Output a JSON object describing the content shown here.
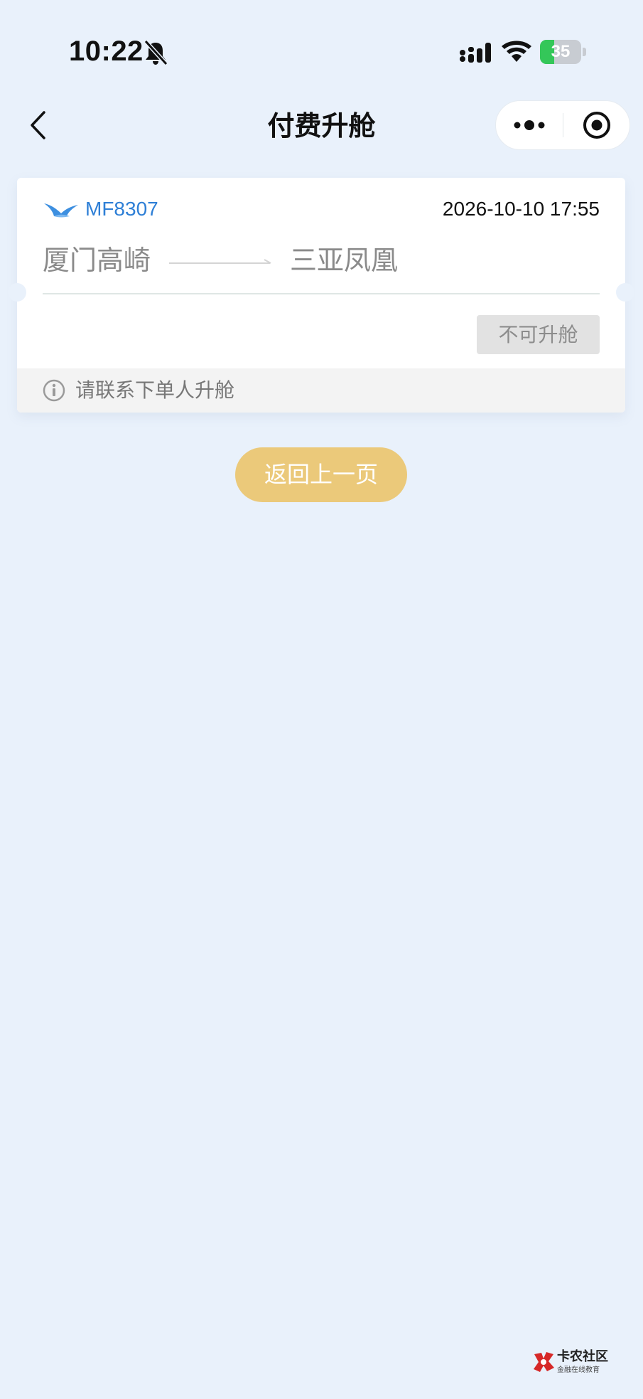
{
  "status_bar": {
    "time": "10:22",
    "battery": "35",
    "battery_level": 0.35
  },
  "nav": {
    "title": "付费升舱"
  },
  "flight": {
    "flight_no": "MF8307",
    "datetime": "2026-10-10 17:55",
    "origin": "厦门高崎",
    "destination": "三亚凤凰",
    "passenger": "",
    "upgrade_status": "不可升舱",
    "notice": "请联系下单人升舱"
  },
  "actions": {
    "return_label": "返回上一页"
  },
  "watermark": {
    "title": "卡农社区",
    "subtitle": "金融在线教育"
  },
  "colors": {
    "background": "#e9f1fb",
    "flight_no": "#2e7fd6",
    "return_button": "#ebc97a",
    "disabled_button": "#e2e2e2"
  }
}
